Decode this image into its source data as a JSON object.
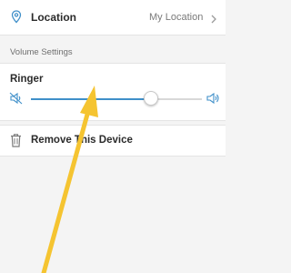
{
  "location": {
    "label": "Location",
    "value": "My Location",
    "pin_icon": "map-pin-icon",
    "chevron_icon": "chevron-right-icon"
  },
  "volume_section": {
    "header": "Volume Settings"
  },
  "ringer": {
    "label": "Ringer",
    "level": 0.7,
    "low_icon": "volume-low-icon",
    "high_icon": "volume-high-icon"
  },
  "remove_device": {
    "label": "Remove This Device",
    "icon": "trash-icon"
  },
  "colors": {
    "accent": "#3f8fc9",
    "annotation_arrow": "#f5c431"
  }
}
